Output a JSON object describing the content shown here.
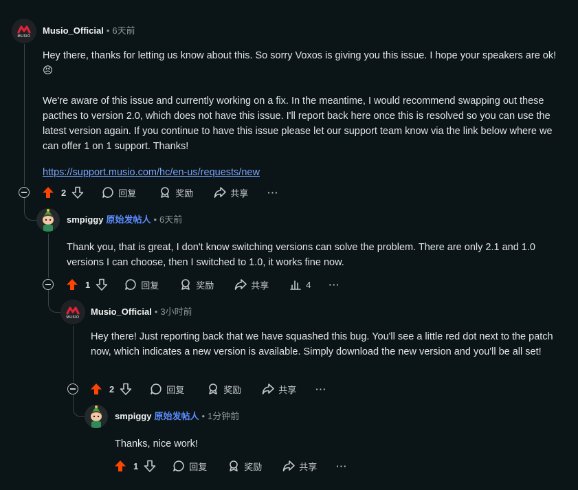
{
  "comments": [
    {
      "author": "Musio_Official",
      "time": "6天前",
      "avatar_text": "MUSIO",
      "paragraphs": [
        "Hey there, thanks for letting us know about this. So sorry Voxos is giving you this issue. I hope your speakers are ok! 😣",
        "We're aware of this issue and currently working on a fix. In the meantime, I would recommend swapping out these pacthes to version 2.0, which does not have this issue. I'll report back here once this is resolved so you can use the latest version again. If you continue to have this issue please let our support team know via the link below where we can offer 1 on 1 support. Thanks!"
      ],
      "link": "https://support.musio.com/hc/en-us/requests/new",
      "votes": "2"
    },
    {
      "author": "smpiggy",
      "op_badge": "原始发帖人",
      "time": "6天前",
      "paragraphs": [
        "Thank you, that is great, I don't know switching versions can solve the problem. There are only 2.1 and 1.0 versions I can choose, then I switched to 1.0, it works fine now."
      ],
      "votes": "1",
      "insights": "4"
    },
    {
      "author": "Musio_Official",
      "time": "3小时前",
      "avatar_text": "MUSIO",
      "paragraphs": [
        "Hey there! Just reporting back that we have squashed this bug. You'll see a little red dot next to the patch now, which indicates a new version is available. Simply download the new version and you'll be all set!"
      ],
      "votes": "2"
    },
    {
      "author": "smpiggy",
      "op_badge": "原始发帖人",
      "time": "1分钟前",
      "paragraphs": [
        "Thanks, nice work!"
      ],
      "votes": "1"
    }
  ],
  "actions": {
    "reply": "回复",
    "award": "奖励",
    "share": "共享",
    "more": "···"
  },
  "separator": "•",
  "colors": {
    "background": "#0b1416",
    "upvote": "#ff4500",
    "op_badge": "#5a8cff",
    "link": "#7aa4ff"
  },
  "icons": [
    "upvote-icon",
    "downvote-icon",
    "reply-icon",
    "award-icon",
    "share-icon",
    "more-icon",
    "insights-icon",
    "collapse-icon"
  ]
}
